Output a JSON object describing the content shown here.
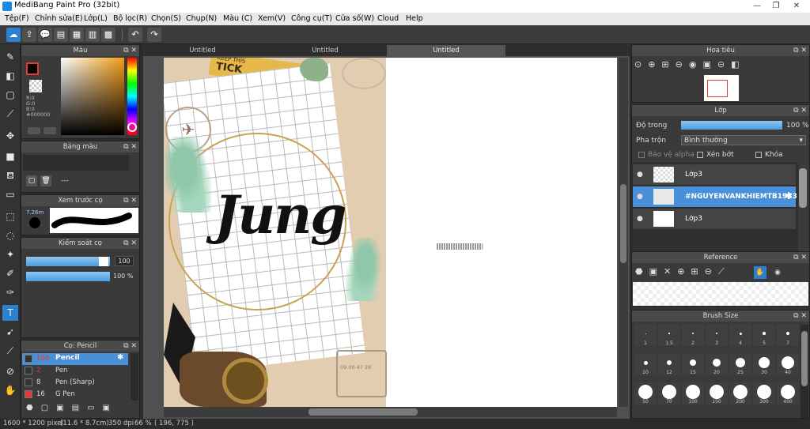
{
  "window": {
    "title": "MediBang Paint Pro (32bit)"
  },
  "menu": [
    "Tệp(F)",
    "Chỉnh sửa(E)",
    "Lớp(L)",
    "Bộ lọc(R)",
    "Chọn(S)",
    "Chụp(N)",
    "Màu (C)",
    "Xem(V)",
    "Công cụ(T)",
    "Cửa số(W)",
    "Cloud",
    "Help"
  ],
  "panels": {
    "color": {
      "title": "Màu",
      "r": "R:0",
      "g": "G:0",
      "b": "B:0",
      "hex": "#000000"
    },
    "palette": {
      "title": "Bảng màu",
      "dash": "---"
    },
    "brush_preview": {
      "title": "Xem trước cọ",
      "size": "7.26m"
    },
    "brush_control": {
      "title": "Kiểm soát cọ",
      "size_value": "100",
      "opacity_value": "100 %"
    },
    "brush_list": {
      "title": "Cọ: Pencil",
      "items": [
        {
          "size": "100",
          "name": "Pencil",
          "color": "#333333"
        },
        {
          "size": "2",
          "name": "Pen",
          "color": "#333333"
        },
        {
          "size": "8",
          "name": "Pen (Sharp)",
          "color": "#333333"
        },
        {
          "size": "16",
          "name": "G Pen",
          "color": "#e53935"
        }
      ]
    },
    "navigator": {
      "title": "Hoa tiêu"
    },
    "layer": {
      "title": "Lớp",
      "opacity_label": "Độ trong",
      "opacity_value": "100 %",
      "blend_label": "Pha trộn",
      "blend_value": "Bình thường",
      "protect_alpha": "Bảo vệ alpha",
      "clip": "Xén bớt",
      "lock": "Khóa",
      "layers": [
        {
          "name": "Lớp3"
        },
        {
          "name": "#NGUYENVANKHIEMTB1983"
        },
        {
          "name": "Lớp3"
        }
      ]
    },
    "reference": {
      "title": "Reference"
    },
    "brush_size": {
      "title": "Brush Size",
      "sizes": [
        "1",
        "1.5",
        "2",
        "3",
        "4",
        "5",
        "7",
        "10",
        "12",
        "15",
        "20",
        "25",
        "30",
        "40",
        "50",
        "70",
        "100",
        "150",
        "200",
        "300",
        "400"
      ]
    }
  },
  "tabs": [
    "Untitled",
    "Untitled",
    "Untitled"
  ],
  "canvas": {
    "word": "Jung",
    "ticket_top": "KEEP THIS",
    "ticket_main": "TICK",
    "stamp_text": "09 00 47 28"
  },
  "status": {
    "size": "1600 * 1200 pixel",
    "cm": "(11.6 * 8.7cm)",
    "dpi": "350 dpi",
    "zoom": "66 %",
    "coords": "( 196, 775 )"
  },
  "colors": {
    "accent": "#2d7fd0",
    "panel": "#3a3a3a",
    "header": "#4a4a4a"
  }
}
